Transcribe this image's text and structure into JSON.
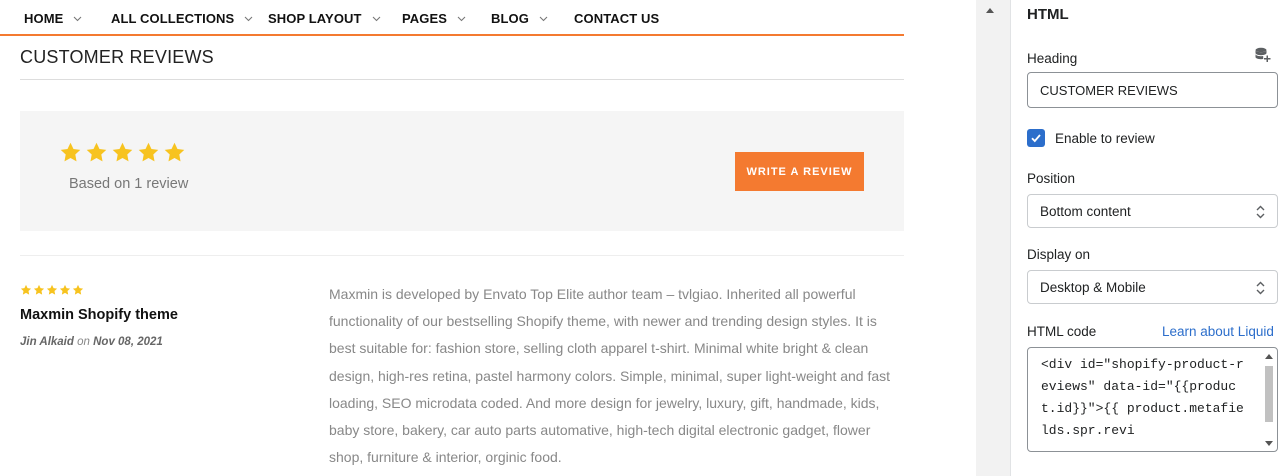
{
  "nav": {
    "items": [
      {
        "label": "HOME",
        "has_dropdown": true
      },
      {
        "label": "ALL COLLECTIONS",
        "has_dropdown": true
      },
      {
        "label": "SHOP LAYOUT",
        "has_dropdown": true
      },
      {
        "label": "PAGES",
        "has_dropdown": true
      },
      {
        "label": "BLOG",
        "has_dropdown": true
      },
      {
        "label": "CONTACT US",
        "has_dropdown": false
      }
    ],
    "accent_color": "#f47a30"
  },
  "reviews": {
    "title": "CUSTOMER REVIEWS",
    "summary": {
      "rating": 5,
      "max_rating": 5,
      "based_on": "Based on 1 review",
      "write_button": "WRITE A REVIEW"
    },
    "items": [
      {
        "rating": 5,
        "title": "Maxmin Shopify theme",
        "author": "Jin Alkaid",
        "on": "on",
        "date": "Nov 08, 2021",
        "body": "Maxmin is developed by Envato Top Elite author team – tvlgiao. Inherited all powerful functionality of our bestselling Shopify theme, with newer and trending design styles. It is best suitable for: fashion store, selling cloth apparel t-shirt. Minimal white bright & clean design, high-res retina, pastel harmony colors. Simple, minimal, super light-weight and fast loading, SEO microdata coded. And more design for jewelry, luxury, gift, handmade, kids, baby store, bakery, car auto parts automative, high-tech digital electronic gadget, flower shop, furniture & interior, orginic food."
      }
    ],
    "star_color": "#f7c31f"
  },
  "panel": {
    "title": "HTML",
    "heading_label": "Heading",
    "heading_value": "CUSTOMER REVIEWS",
    "enable_label": "Enable to review",
    "enable_checked": true,
    "position_label": "Position",
    "position_value": "Bottom content",
    "display_label": "Display on",
    "display_value": "Desktop & Mobile",
    "code_label": "HTML code",
    "code_link": "Learn about Liquid",
    "code_value": "<div id=\"shopify-product-reviews\" data-id=\"{{product.id}}\">{{ product.metafields.spr.revi",
    "checkbox_color": "#2c6ecb"
  }
}
